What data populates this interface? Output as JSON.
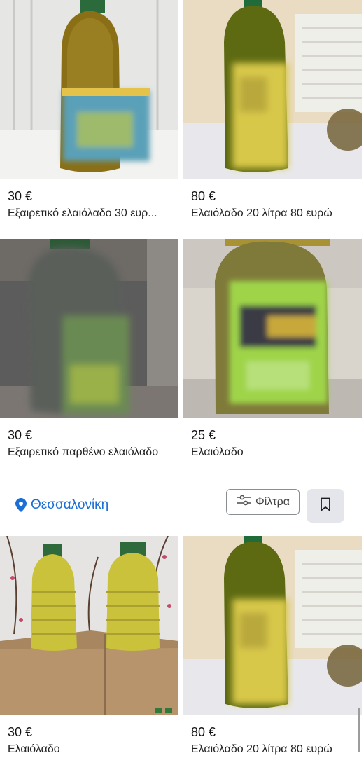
{
  "listings": [
    {
      "price": "30 €",
      "title": "Εξαιρετικό ελαιόλαδο 30 ευρ..."
    },
    {
      "price": "80 €",
      "title": "Ελαιόλαδο 20 λίτρα 80 ευρώ"
    },
    {
      "price": "30 €",
      "title": "Εξαιρετικό παρθένο ελαιόλαδο"
    },
    {
      "price": "25 €",
      "title": "Ελαιόλαδο"
    },
    {
      "price": "30 €",
      "title": "Ελαιόλαδο"
    },
    {
      "price": "80 €",
      "title": "Ελαιόλαδο 20 λίτρα 80 ευρώ"
    }
  ],
  "toolbar": {
    "location": "Θεσσαλονίκη",
    "filters_label": "Φίλτρα"
  },
  "icons": {
    "location": "map-pin-icon",
    "filters": "sliders-icon",
    "save": "bookmark-icon"
  },
  "colors": {
    "accent": "#1a6ed8",
    "button_bg": "#e4e6eb"
  }
}
